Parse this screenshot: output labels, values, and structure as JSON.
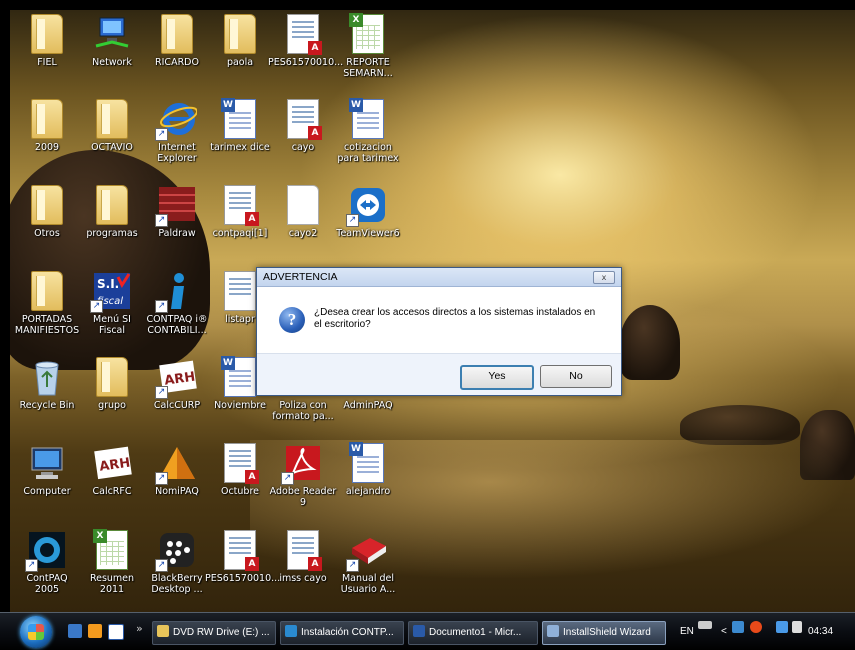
{
  "desktop": {
    "icons": [
      {
        "label": "FIEL"
      },
      {
        "label": "Network"
      },
      {
        "label": "RICARDO"
      },
      {
        "label": "paola"
      },
      {
        "label": "PES61570010..."
      },
      {
        "label": "REPORTE\nSEMARN..."
      },
      {
        "label": "2009"
      },
      {
        "label": "OCTAVIO"
      },
      {
        "label": "Internet\nExplorer"
      },
      {
        "label": "tarimex dice"
      },
      {
        "label": "cayo"
      },
      {
        "label": "cotizacion\npara tarimex"
      },
      {
        "label": "Otros"
      },
      {
        "label": "programas"
      },
      {
        "label": "Paldraw"
      },
      {
        "label": "contpaqi[1]"
      },
      {
        "label": "cayo2"
      },
      {
        "label": "TeamViewer6"
      },
      {
        "label": "PORTADAS\nMANIFIESTOS"
      },
      {
        "label": "Menú SI\nFiscal"
      },
      {
        "label": "CONTPAQ i®\nCONTABILI..."
      },
      {
        "label": "listapr"
      },
      {
        "label": "Recycle Bin"
      },
      {
        "label": "grupo"
      },
      {
        "label": "CalcCURP"
      },
      {
        "label": "Noviembre"
      },
      {
        "label": "Poliza con\nformato pa..."
      },
      {
        "label": "AdminPAQ"
      },
      {
        "label": "Computer"
      },
      {
        "label": "CalcRFC"
      },
      {
        "label": "NomiPAQ"
      },
      {
        "label": "Octubre"
      },
      {
        "label": "Adobe Reader\n9"
      },
      {
        "label": "alejandro"
      },
      {
        "label": "ContPAQ\n2005"
      },
      {
        "label": "Resumen\n2011"
      },
      {
        "label": "BlackBerry\nDesktop ..."
      },
      {
        "label": "PES61570010..."
      },
      {
        "label": "imss cayo"
      },
      {
        "label": "Manual del\nUsuario A..."
      }
    ]
  },
  "dialog": {
    "title": "ADVERTENCIA",
    "close_label": "x",
    "message": "¿Desea crear los accesos directos a los sistemas instalados en el escritorio?",
    "yes_label": "Yes",
    "no_label": "No"
  },
  "taskbar": {
    "quicklaunch_chevron": "»",
    "tasks": [
      {
        "label": "DVD RW Drive (E:) ..."
      },
      {
        "label": "Instalación CONTP..."
      },
      {
        "label": "Documento1 - Micr..."
      },
      {
        "label": "InstallShield Wizard"
      }
    ],
    "tray": {
      "language": "EN",
      "chevron": "<",
      "clock": "04:34 p.m."
    }
  }
}
